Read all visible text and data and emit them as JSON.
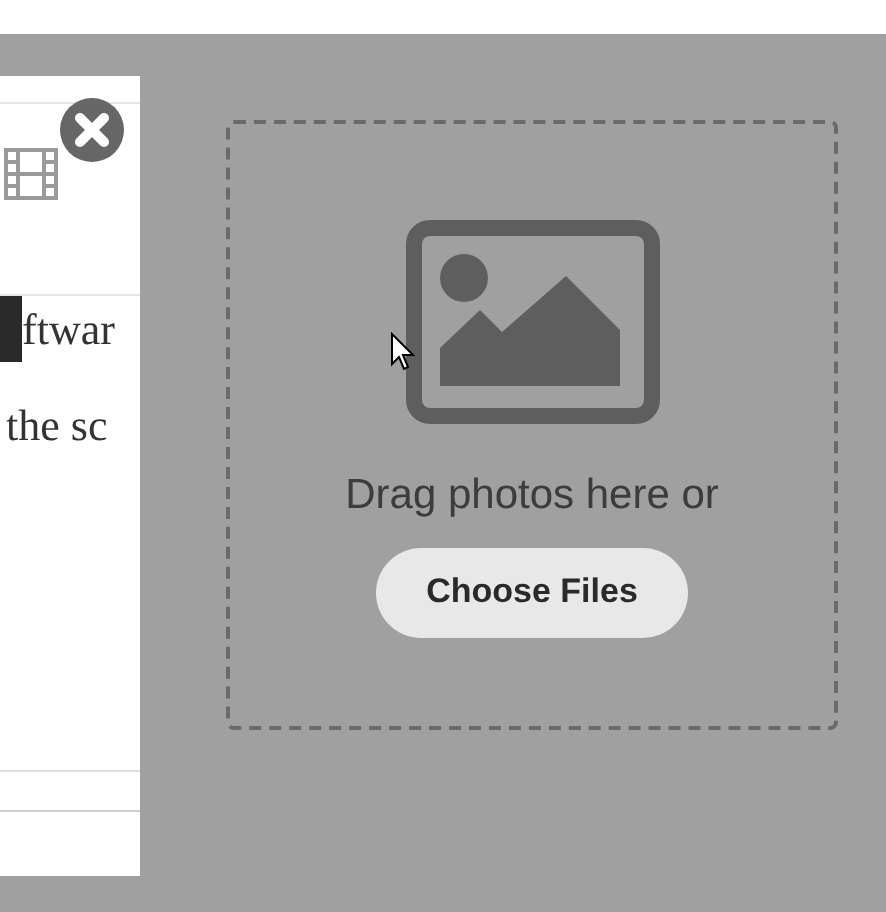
{
  "background_page": {
    "lines": [
      "ftwar",
      "the sc"
    ]
  },
  "dropzone": {
    "prompt": "Drag photos here or",
    "button": "Choose Files"
  }
}
